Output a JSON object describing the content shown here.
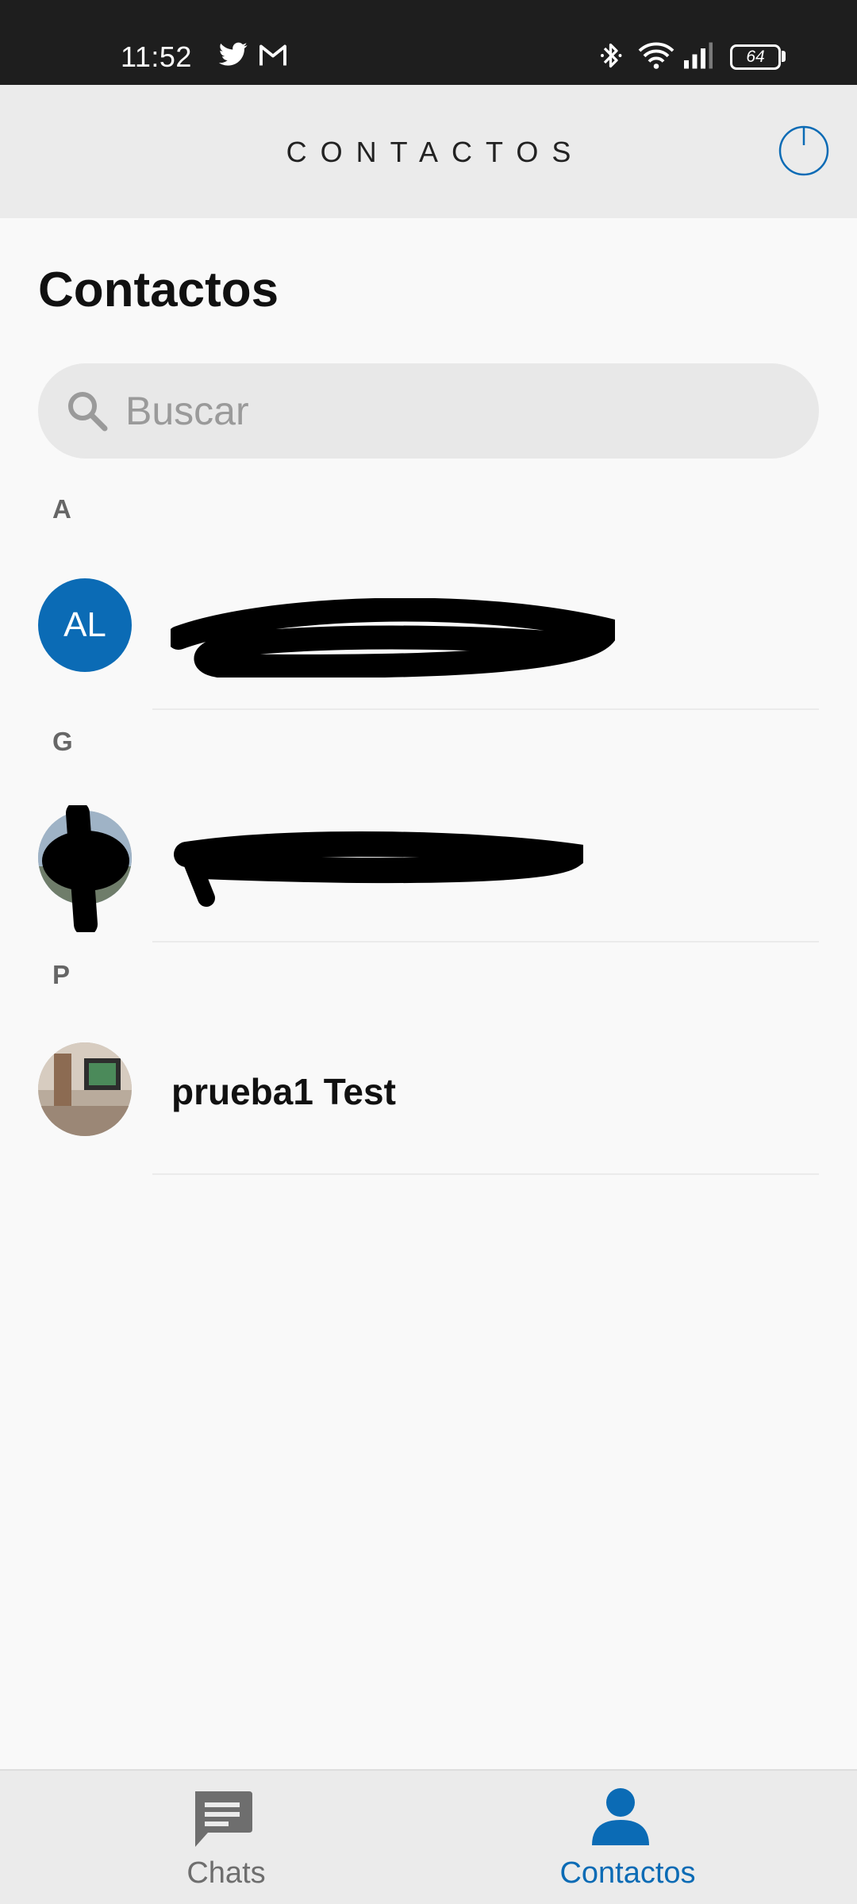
{
  "status_bar": {
    "time": "11:52",
    "battery_level": "64",
    "icons": [
      "twitter-icon",
      "gmail-icon",
      "bluetooth-icon",
      "wifi-icon",
      "signal-icon",
      "battery-icon"
    ]
  },
  "header": {
    "title": "CONTACTOS",
    "power_icon": "power-icon"
  },
  "page": {
    "title": "Contactos"
  },
  "search": {
    "placeholder": "Buscar",
    "value": ""
  },
  "sections": [
    {
      "letter": "A",
      "contacts": [
        {
          "initials": "AL",
          "name": "",
          "redacted": true
        }
      ]
    },
    {
      "letter": "G",
      "contacts": [
        {
          "initials": "",
          "name": "",
          "redacted": true,
          "avatar": "photo"
        }
      ]
    },
    {
      "letter": "P",
      "contacts": [
        {
          "initials": "",
          "name": "prueba1 Test",
          "redacted": false,
          "avatar": "photo"
        }
      ]
    }
  ],
  "bottom_nav": {
    "items": [
      {
        "label": "Chats",
        "icon": "chat-icon",
        "active": false
      },
      {
        "label": "Contactos",
        "icon": "person-icon",
        "active": true
      }
    ]
  },
  "colors": {
    "accent": "#0b6bb5",
    "status_bar_bg": "#1e1e1e",
    "header_bg": "#ebebeb",
    "page_bg": "#f9f9f9",
    "inactive_nav": "#6e6e6e"
  }
}
